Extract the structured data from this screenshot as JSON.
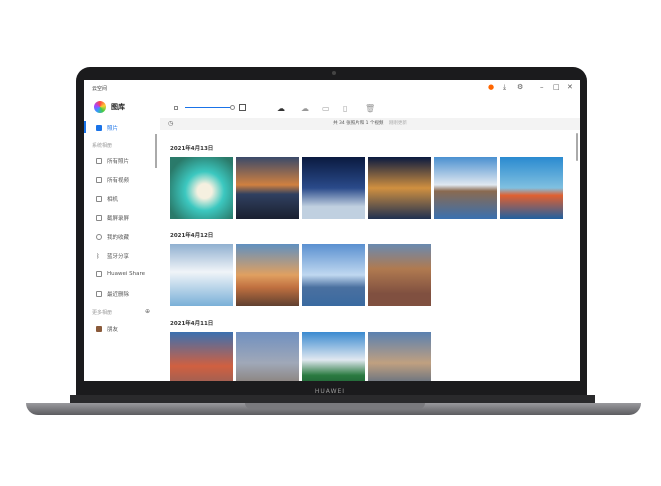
{
  "window": {
    "title": "云空间",
    "brand": "HUAWEI"
  },
  "sidebar": {
    "app_name": "图库",
    "active": "照片",
    "section_system": "系统相册",
    "items": [
      "所有照片",
      "所有视频",
      "相机",
      "截屏录屏",
      "我的收藏",
      "蓝牙分享",
      "Huawei Share",
      "最近删除"
    ],
    "section_more": "更多相册",
    "more_items": [
      "朋友"
    ]
  },
  "toolbar": {
    "icons": [
      "upload-icon",
      "download-icon",
      "folder-icon",
      "copy-icon",
      "delete-icon"
    ]
  },
  "status": {
    "summary": "共 34 张照片和 1 个视频",
    "updated": "刚刚更新"
  },
  "groups": [
    {
      "date": "2021年4月13日",
      "count": 6
    },
    {
      "date": "2021年4月12日",
      "count": 4
    },
    {
      "date": "2021年4月11日",
      "count": 4
    }
  ],
  "accent": "#1a73e8"
}
